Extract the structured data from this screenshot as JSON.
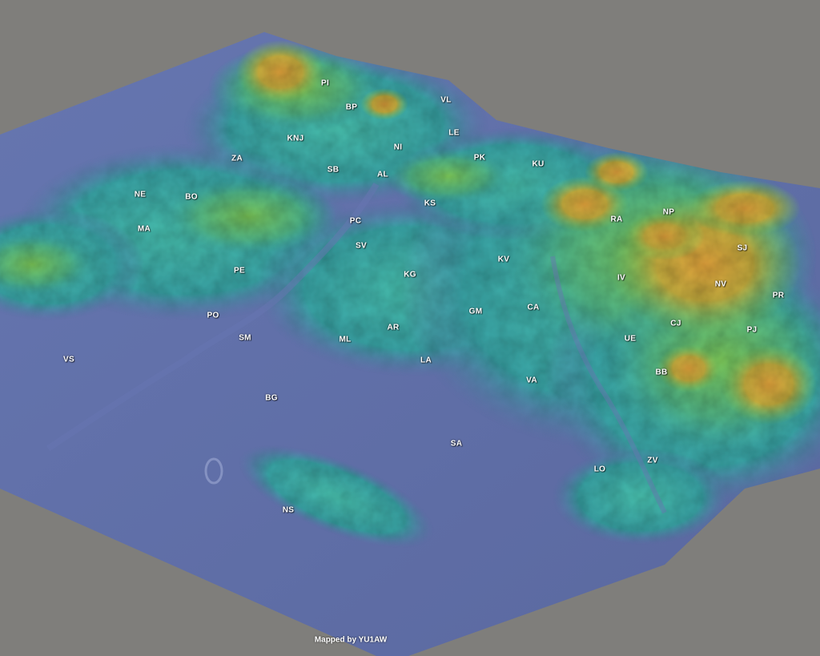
{
  "map": {
    "credit": "Mapped by YU1AW",
    "colors": {
      "background": "#7f7e7b",
      "lowland": "#5f6fa6",
      "hills": "#3fb0a8",
      "uplands": "#6fbf5f",
      "highlands": "#c8b040",
      "peaks": "#d89a3a"
    },
    "labels": [
      {
        "id": "PI",
        "text": "PI"
      },
      {
        "id": "BP",
        "text": "BP"
      },
      {
        "id": "VL",
        "text": "VL"
      },
      {
        "id": "LE",
        "text": "LE"
      },
      {
        "id": "KNJ",
        "text": "KNJ"
      },
      {
        "id": "NI",
        "text": "NI"
      },
      {
        "id": "ZA",
        "text": "ZA"
      },
      {
        "id": "SB",
        "text": "SB"
      },
      {
        "id": "AL",
        "text": "AL"
      },
      {
        "id": "PK",
        "text": "PK"
      },
      {
        "id": "KU",
        "text": "KU"
      },
      {
        "id": "NE",
        "text": "NE"
      },
      {
        "id": "BO",
        "text": "BO"
      },
      {
        "id": "KS",
        "text": "KS"
      },
      {
        "id": "RA",
        "text": "RA"
      },
      {
        "id": "NP",
        "text": "NP"
      },
      {
        "id": "MA",
        "text": "MA"
      },
      {
        "id": "PC",
        "text": "PC"
      },
      {
        "id": "SV",
        "text": "SV"
      },
      {
        "id": "SJ",
        "text": "SJ"
      },
      {
        "id": "KV",
        "text": "KV"
      },
      {
        "id": "PE",
        "text": "PE"
      },
      {
        "id": "KG",
        "text": "KG"
      },
      {
        "id": "IV",
        "text": "IV"
      },
      {
        "id": "NV",
        "text": "NV"
      },
      {
        "id": "PR",
        "text": "PR"
      },
      {
        "id": "CA",
        "text": "CA"
      },
      {
        "id": "GM",
        "text": "GM"
      },
      {
        "id": "PO",
        "text": "PO"
      },
      {
        "id": "CJ",
        "text": "CJ"
      },
      {
        "id": "AR",
        "text": "AR"
      },
      {
        "id": "PJ",
        "text": "PJ"
      },
      {
        "id": "SM",
        "text": "SM"
      },
      {
        "id": "ML",
        "text": "ML"
      },
      {
        "id": "UE",
        "text": "UE"
      },
      {
        "id": "VS",
        "text": "VS"
      },
      {
        "id": "LA",
        "text": "LA"
      },
      {
        "id": "BB",
        "text": "BB"
      },
      {
        "id": "VA",
        "text": "VA"
      },
      {
        "id": "BG",
        "text": "BG"
      },
      {
        "id": "SA",
        "text": "SA"
      },
      {
        "id": "ZV",
        "text": "ZV"
      },
      {
        "id": "LO",
        "text": "LO"
      },
      {
        "id": "NS",
        "text": "NS"
      }
    ]
  }
}
